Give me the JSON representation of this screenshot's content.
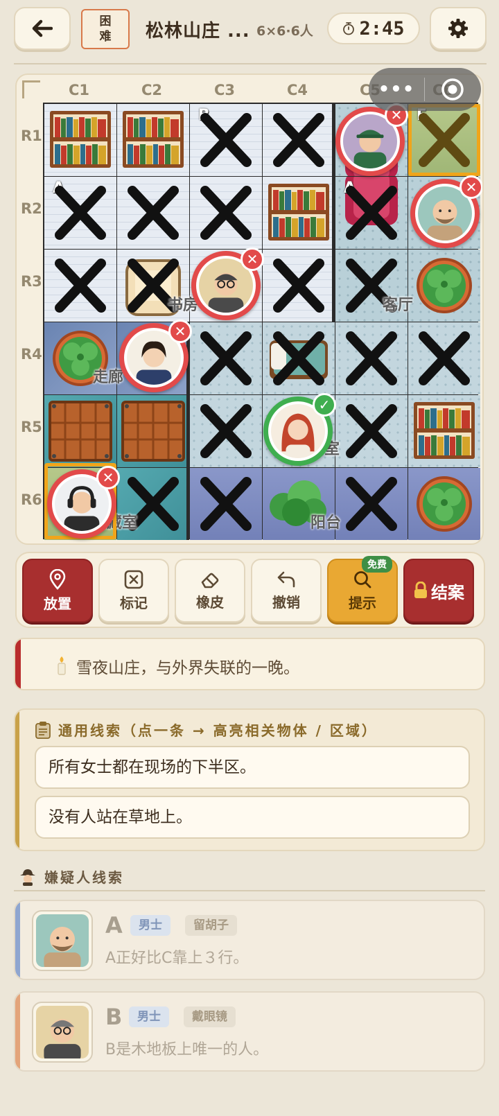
{
  "header": {
    "difficulty": "困难",
    "title": "松林山庄 ...",
    "subtitle": "6×6·6人",
    "timer": "2:45"
  },
  "board": {
    "columns": [
      "C1",
      "C2",
      "C3",
      "C4",
      "C5",
      "C6"
    ],
    "rows": [
      "R1",
      "R2",
      "R3",
      "R4",
      "R5",
      "R6"
    ],
    "room_labels": {
      "study": "书房",
      "living": "客厅",
      "hall": "走廊",
      "bedroom": "卧室",
      "storage": "储藏室",
      "balcony": "阳台"
    },
    "cell_tags": {
      "r1c3": "B",
      "r1c6": "E",
      "r2c1": "A",
      "r2c5": "A"
    },
    "status_marks": {
      "wrong": "✕",
      "correct": "✓"
    }
  },
  "capsule": {
    "more": "•••"
  },
  "toolbar": {
    "place": "放置",
    "mark": "标记",
    "eraser": "橡皮",
    "undo": "撤销",
    "hint": "提示",
    "free": "免费",
    "solve": "结案"
  },
  "story": {
    "text": "雪夜山庄，与外界失联的一晚。"
  },
  "general_clues": {
    "heading": "通用线索（点一条 → 高亮相关物体 / 区域）",
    "items": [
      "所有女士都在现场的下半区。",
      "没有人站在草地上。"
    ]
  },
  "suspects": {
    "heading": "嫌疑人线索",
    "list": [
      {
        "letter": "A",
        "gender": "男士",
        "trait": "留胡子",
        "clue": "A正好比C靠上３行。",
        "accent": "#8fa6d0"
      },
      {
        "letter": "B",
        "gender": "男士",
        "trait": "戴眼镜",
        "clue": "B是木地板上唯一的人。",
        "accent": "#e3a47a"
      }
    ]
  },
  "colors": {
    "accent_red": "#a82f2f",
    "accent_gold": "#e9a833",
    "wrong": "#e24a4a",
    "correct": "#3fae4f"
  }
}
